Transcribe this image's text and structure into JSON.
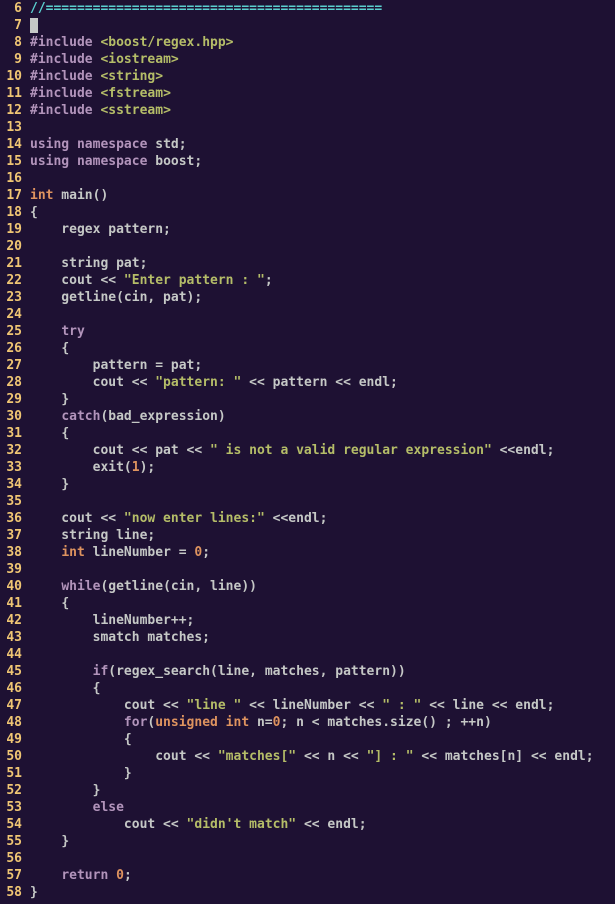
{
  "editor": {
    "first_line_number": 6,
    "last_line_number": 58,
    "cursor_line": 7,
    "lines": [
      {
        "n": 6,
        "tokens": [
          {
            "cls": "c-comment",
            "t": "//==========================================="
          }
        ]
      },
      {
        "n": 7,
        "tokens": [
          {
            "cls": "cursor",
            "t": " "
          }
        ]
      },
      {
        "n": 8,
        "tokens": [
          {
            "cls": "c-preproc",
            "t": "#include"
          },
          {
            "cls": "c-ident",
            "t": " "
          },
          {
            "cls": "c-preproc-val",
            "t": "<boost/regex.hpp>"
          }
        ]
      },
      {
        "n": 9,
        "tokens": [
          {
            "cls": "c-preproc",
            "t": "#include"
          },
          {
            "cls": "c-ident",
            "t": " "
          },
          {
            "cls": "c-preproc-val",
            "t": "<iostream>"
          }
        ]
      },
      {
        "n": 10,
        "tokens": [
          {
            "cls": "c-preproc",
            "t": "#include"
          },
          {
            "cls": "c-ident",
            "t": " "
          },
          {
            "cls": "c-preproc-val",
            "t": "<string>"
          }
        ]
      },
      {
        "n": 11,
        "tokens": [
          {
            "cls": "c-preproc",
            "t": "#include"
          },
          {
            "cls": "c-ident",
            "t": " "
          },
          {
            "cls": "c-preproc-val",
            "t": "<fstream>"
          }
        ]
      },
      {
        "n": 12,
        "tokens": [
          {
            "cls": "c-preproc",
            "t": "#include"
          },
          {
            "cls": "c-ident",
            "t": " "
          },
          {
            "cls": "c-preproc-val",
            "t": "<sstream>"
          }
        ]
      },
      {
        "n": 13,
        "tokens": []
      },
      {
        "n": 14,
        "tokens": [
          {
            "cls": "c-keyword",
            "t": "using"
          },
          {
            "cls": "c-ident",
            "t": " "
          },
          {
            "cls": "c-keyword",
            "t": "namespace"
          },
          {
            "cls": "c-ident",
            "t": " std;"
          }
        ]
      },
      {
        "n": 15,
        "tokens": [
          {
            "cls": "c-keyword",
            "t": "using"
          },
          {
            "cls": "c-ident",
            "t": " "
          },
          {
            "cls": "c-keyword",
            "t": "namespace"
          },
          {
            "cls": "c-ident",
            "t": " boost;"
          }
        ]
      },
      {
        "n": 16,
        "tokens": []
      },
      {
        "n": 17,
        "tokens": [
          {
            "cls": "c-type",
            "t": "int"
          },
          {
            "cls": "c-ident",
            "t": " main()"
          }
        ]
      },
      {
        "n": 18,
        "tokens": [
          {
            "cls": "c-brace",
            "t": "{"
          }
        ]
      },
      {
        "n": 19,
        "tokens": [
          {
            "cls": "c-ident",
            "t": "    regex pattern;"
          }
        ]
      },
      {
        "n": 20,
        "tokens": []
      },
      {
        "n": 21,
        "tokens": [
          {
            "cls": "c-ident",
            "t": "    string pat;"
          }
        ]
      },
      {
        "n": 22,
        "tokens": [
          {
            "cls": "c-ident",
            "t": "    cout << "
          },
          {
            "cls": "c-string",
            "t": "\"Enter pattern : \""
          },
          {
            "cls": "c-ident",
            "t": ";"
          }
        ]
      },
      {
        "n": 23,
        "tokens": [
          {
            "cls": "c-ident",
            "t": "    getline(cin, pat);"
          }
        ]
      },
      {
        "n": 24,
        "tokens": []
      },
      {
        "n": 25,
        "tokens": [
          {
            "cls": "c-ident",
            "t": "    "
          },
          {
            "cls": "c-keyword",
            "t": "try"
          }
        ]
      },
      {
        "n": 26,
        "tokens": [
          {
            "cls": "c-ident",
            "t": "    "
          },
          {
            "cls": "c-brace",
            "t": "{"
          }
        ]
      },
      {
        "n": 27,
        "tokens": [
          {
            "cls": "c-ident",
            "t": "        pattern = pat;"
          }
        ]
      },
      {
        "n": 28,
        "tokens": [
          {
            "cls": "c-ident",
            "t": "        cout << "
          },
          {
            "cls": "c-string",
            "t": "\"pattern: \""
          },
          {
            "cls": "c-ident",
            "t": " << pattern << endl;"
          }
        ]
      },
      {
        "n": 29,
        "tokens": [
          {
            "cls": "c-ident",
            "t": "    "
          },
          {
            "cls": "c-brace",
            "t": "}"
          }
        ]
      },
      {
        "n": 30,
        "tokens": [
          {
            "cls": "c-ident",
            "t": "    "
          },
          {
            "cls": "c-keyword",
            "t": "catch"
          },
          {
            "cls": "c-ident",
            "t": "(bad_expression)"
          }
        ]
      },
      {
        "n": 31,
        "tokens": [
          {
            "cls": "c-ident",
            "t": "    "
          },
          {
            "cls": "c-brace",
            "t": "{"
          }
        ]
      },
      {
        "n": 32,
        "tokens": [
          {
            "cls": "c-ident",
            "t": "        cout << pat << "
          },
          {
            "cls": "c-string",
            "t": "\" is not a valid regular expression\""
          },
          {
            "cls": "c-ident",
            "t": " <<endl;"
          }
        ]
      },
      {
        "n": 33,
        "tokens": [
          {
            "cls": "c-ident",
            "t": "        exit("
          },
          {
            "cls": "c-number",
            "t": "1"
          },
          {
            "cls": "c-ident",
            "t": ");"
          }
        ]
      },
      {
        "n": 34,
        "tokens": [
          {
            "cls": "c-ident",
            "t": "    "
          },
          {
            "cls": "c-brace",
            "t": "}"
          }
        ]
      },
      {
        "n": 35,
        "tokens": []
      },
      {
        "n": 36,
        "tokens": [
          {
            "cls": "c-ident",
            "t": "    cout << "
          },
          {
            "cls": "c-string",
            "t": "\"now enter lines:\""
          },
          {
            "cls": "c-ident",
            "t": " <<endl;"
          }
        ]
      },
      {
        "n": 37,
        "tokens": [
          {
            "cls": "c-ident",
            "t": "    string line;"
          }
        ]
      },
      {
        "n": 38,
        "tokens": [
          {
            "cls": "c-ident",
            "t": "    "
          },
          {
            "cls": "c-type",
            "t": "int"
          },
          {
            "cls": "c-ident",
            "t": " lineNumber = "
          },
          {
            "cls": "c-number",
            "t": "0"
          },
          {
            "cls": "c-ident",
            "t": ";"
          }
        ]
      },
      {
        "n": 39,
        "tokens": []
      },
      {
        "n": 40,
        "tokens": [
          {
            "cls": "c-ident",
            "t": "    "
          },
          {
            "cls": "c-keyword",
            "t": "while"
          },
          {
            "cls": "c-ident",
            "t": "(getline(cin, line))"
          }
        ]
      },
      {
        "n": 41,
        "tokens": [
          {
            "cls": "c-ident",
            "t": "    "
          },
          {
            "cls": "c-brace",
            "t": "{"
          }
        ]
      },
      {
        "n": 42,
        "tokens": [
          {
            "cls": "c-ident",
            "t": "        lineNumber++;"
          }
        ]
      },
      {
        "n": 43,
        "tokens": [
          {
            "cls": "c-ident",
            "t": "        smatch matches;"
          }
        ]
      },
      {
        "n": 44,
        "tokens": []
      },
      {
        "n": 45,
        "tokens": [
          {
            "cls": "c-ident",
            "t": "        "
          },
          {
            "cls": "c-keyword",
            "t": "if"
          },
          {
            "cls": "c-ident",
            "t": "(regex_search(line, matches, pattern))"
          }
        ]
      },
      {
        "n": 46,
        "tokens": [
          {
            "cls": "c-ident",
            "t": "        "
          },
          {
            "cls": "c-brace",
            "t": "{"
          }
        ]
      },
      {
        "n": 47,
        "tokens": [
          {
            "cls": "c-ident",
            "t": "            cout << "
          },
          {
            "cls": "c-string",
            "t": "\"line \""
          },
          {
            "cls": "c-ident",
            "t": " << lineNumber << "
          },
          {
            "cls": "c-string",
            "t": "\" : \""
          },
          {
            "cls": "c-ident",
            "t": " << line << endl;"
          }
        ]
      },
      {
        "n": 48,
        "tokens": [
          {
            "cls": "c-ident",
            "t": "            "
          },
          {
            "cls": "c-keyword",
            "t": "for"
          },
          {
            "cls": "c-ident",
            "t": "("
          },
          {
            "cls": "c-type",
            "t": "unsigned int"
          },
          {
            "cls": "c-ident",
            "t": " n="
          },
          {
            "cls": "c-number",
            "t": "0"
          },
          {
            "cls": "c-ident",
            "t": "; n < matches.size() ; ++n)"
          }
        ]
      },
      {
        "n": 49,
        "tokens": [
          {
            "cls": "c-ident",
            "t": "            "
          },
          {
            "cls": "c-brace",
            "t": "{"
          }
        ]
      },
      {
        "n": 50,
        "tokens": [
          {
            "cls": "c-ident",
            "t": "                cout << "
          },
          {
            "cls": "c-string",
            "t": "\"matches[\""
          },
          {
            "cls": "c-ident",
            "t": " << n << "
          },
          {
            "cls": "c-string",
            "t": "\"] : \""
          },
          {
            "cls": "c-ident",
            "t": " << matches[n] << endl;"
          }
        ]
      },
      {
        "n": 51,
        "tokens": [
          {
            "cls": "c-ident",
            "t": "            "
          },
          {
            "cls": "c-brace",
            "t": "}"
          }
        ]
      },
      {
        "n": 52,
        "tokens": [
          {
            "cls": "c-ident",
            "t": "        "
          },
          {
            "cls": "c-brace",
            "t": "}"
          }
        ]
      },
      {
        "n": 53,
        "tokens": [
          {
            "cls": "c-ident",
            "t": "        "
          },
          {
            "cls": "c-keyword",
            "t": "else"
          }
        ]
      },
      {
        "n": 54,
        "tokens": [
          {
            "cls": "c-ident",
            "t": "            cout << "
          },
          {
            "cls": "c-string",
            "t": "\"didn't match\""
          },
          {
            "cls": "c-ident",
            "t": " << endl;"
          }
        ]
      },
      {
        "n": 55,
        "tokens": [
          {
            "cls": "c-ident",
            "t": "    "
          },
          {
            "cls": "c-brace",
            "t": "}"
          }
        ]
      },
      {
        "n": 56,
        "tokens": []
      },
      {
        "n": 57,
        "tokens": [
          {
            "cls": "c-ident",
            "t": "    "
          },
          {
            "cls": "c-keyword",
            "t": "return"
          },
          {
            "cls": "c-ident",
            "t": " "
          },
          {
            "cls": "c-number",
            "t": "0"
          },
          {
            "cls": "c-ident",
            "t": ";"
          }
        ]
      },
      {
        "n": 58,
        "tokens": [
          {
            "cls": "c-brace",
            "t": "}"
          }
        ]
      }
    ]
  }
}
